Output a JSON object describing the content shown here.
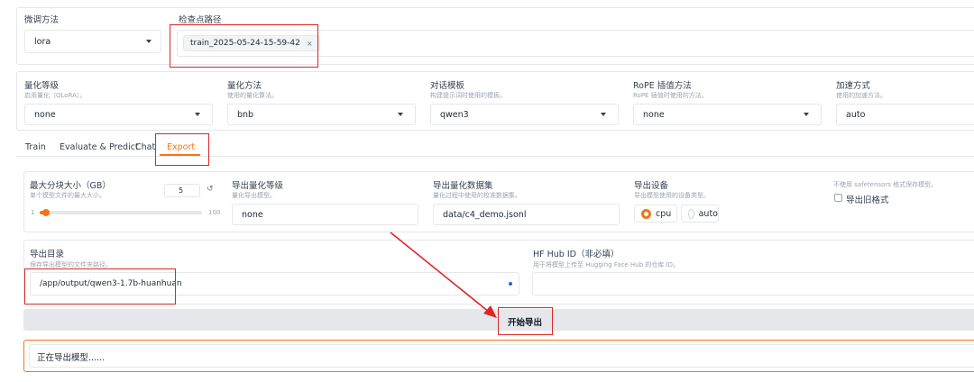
{
  "finetune": {
    "label": "微调方法",
    "value": "lora",
    "checkpoint_label": "检查点路径",
    "checkpoint_tag": "train_2025-05-24-15-59-42",
    "tag_close": "×"
  },
  "quant_level": {
    "label": "量化等级",
    "info": "启用量化（QLoRA）。",
    "value": "none"
  },
  "quant_method": {
    "label": "量化方法",
    "info": "使用的量化算法。",
    "value": "bnb"
  },
  "template": {
    "label": "对话模板",
    "info": "构建提示词时使用的模板。",
    "value": "qwen3"
  },
  "rope": {
    "label": "RoPE 插值方法",
    "info": "RoPE 插值时使用的方法。",
    "value": "none"
  },
  "booster": {
    "label": "加速方式",
    "info": "使用的加速方法。",
    "value": "auto"
  },
  "tabs": [
    {
      "label": "Train"
    },
    {
      "label": "Evaluate & Predict"
    },
    {
      "label": "Chat"
    },
    {
      "label": "Export"
    }
  ],
  "export": {
    "size": {
      "label": "最大分块大小（GB）",
      "info": "单个模型文件的最大大小。",
      "value": "5",
      "reset": "↺",
      "min": "1",
      "max": "100",
      "fraction": 0.04
    },
    "quant_bit": {
      "label": "导出量化等级",
      "info": "量化导出模型。",
      "value": "none"
    },
    "quant_dataset": {
      "label": "导出量化数据集",
      "info": "量化过程中使用的校准数据集。",
      "value": "data/c4_demo.jsonl"
    },
    "device": {
      "label": "导出设备",
      "info": "导出模型使用的设备类型。",
      "options": [
        "cpu",
        "auto"
      ],
      "selected": "cpu"
    },
    "legacy": {
      "info": "不使用 safetensors 格式保存模型。",
      "label": "导出旧格式"
    },
    "dir": {
      "label": "导出目录",
      "info": "保存导出模型的文件夹路径。",
      "value": "/app/output/qwen3-1.7b-huanhuan"
    },
    "hub": {
      "label": "HF Hub ID（非必填）",
      "info": "用于将模型上传至 Hugging Face Hub 的仓库 ID。",
      "value": ""
    },
    "button": "开始导出",
    "status": "正在导出模型......"
  },
  "colors": {
    "accent": "#f97316",
    "annotation": "#dc2626"
  }
}
